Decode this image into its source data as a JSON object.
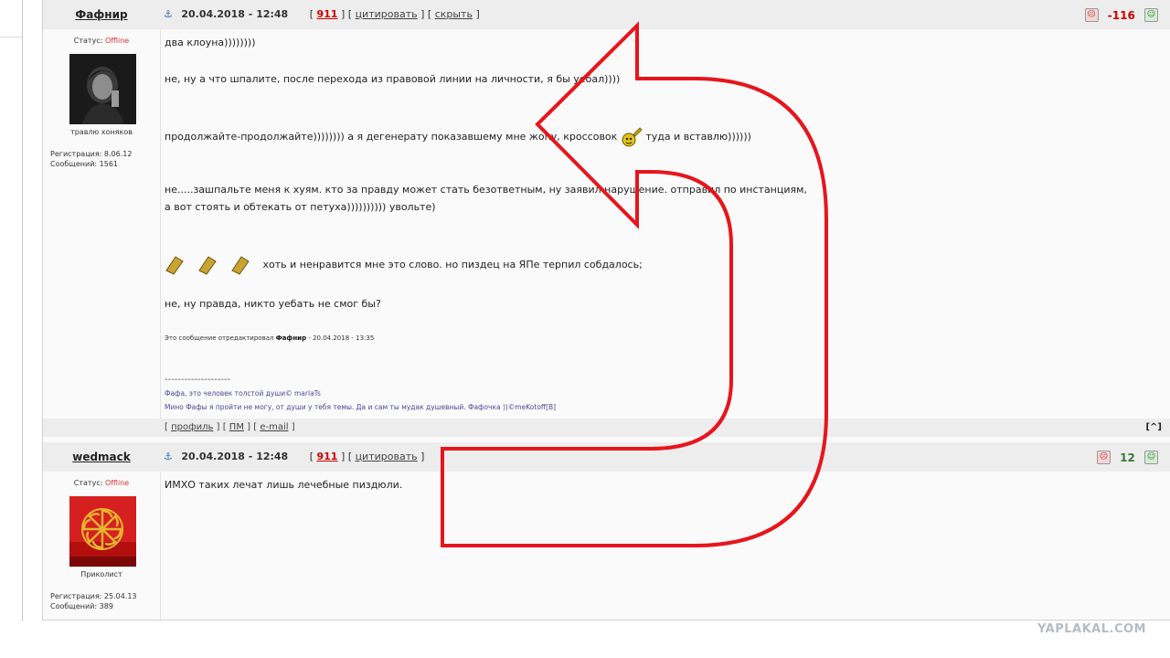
{
  "posts": [
    {
      "author": "Фафнир",
      "date": "20.04.2018 - 12:48",
      "actions": {
        "open": "[",
        "num": "911",
        "sep1": "] [",
        "quote": "цитировать",
        "sep2": "] [",
        "hide": "скрыть",
        "close": "]"
      },
      "rating": "-116",
      "status_label": "Статус:",
      "status_value": "Offline",
      "user_title": "травлю хоняков",
      "reg_label": "Регистрация: 8.06.12",
      "msgs_label": "Сообщений: 1561",
      "lines": [
        "два клоуна))))))))",
        "не, ну а что шпалите, после перехода из правовой линии на личности, я бы уебал))))",
        "продолжайте-продолжайте)))))))) а я дегенерату показавшему мне жопу, кроссовок",
        "туда и вставлю))))))",
        "не.....зашпальте меня к хуям. кто за правду может стать безответным, ну заявил нарушение. отправил по инстанциям,",
        "а вот стоять и обтекать от петуха)))))))))) увольте)",
        "хоть и ненравится мне это слово. но пиздец на ЯПе терпил собдалось;",
        "не, ну правда, никто уебать не смог бы?"
      ],
      "edit_prefix": "Это сообщение отредактировал",
      "edit_author": "Фафнир",
      "edit_suffix": "- 20.04.2018 - 13:35",
      "sig_sep": "--------------------",
      "sig_line1": "Фафа, это человек толстой души© marlaTs",
      "sig_line2": "Мино Фафы я пройти не могу, от души у тебя темы. Да и сам ты мудак душевный. Фафочка ))©meKotoff[B]",
      "footer": {
        "b1": "[",
        "profile": "профиль",
        "b2": "] [",
        "pm": "ПМ",
        "b3": "] [",
        "email": "e-mail",
        "b4": "]"
      },
      "to_top": "[^]"
    },
    {
      "author": "wedmack",
      "date": "20.04.2018 - 12:48",
      "actions": {
        "open": "[",
        "num": "911",
        "sep1": "] [",
        "quote": "цитировать",
        "close": "]"
      },
      "rating": "12",
      "status_label": "Статус:",
      "status_value": "Offline",
      "user_title": "Приколист",
      "reg_label": "Регистрация: 25.04.13",
      "msgs_label": "Сообщений: 389",
      "lines": [
        "ИМХО таких лечат лишь лечебные пиздюли."
      ]
    }
  ],
  "watermark": "YAPLAKAL.COM",
  "colors": {
    "header_bg": "#ededed",
    "offline": "#dd3333",
    "negative": "#cc0000",
    "positive": "#3a7a3a",
    "arrow": "#e8141b"
  },
  "icons": [
    "anchor-icon",
    "rate-down-icon",
    "rate-up-icon",
    "sneaker-emoji",
    "slipper-emoji",
    "curved-arrow"
  ]
}
